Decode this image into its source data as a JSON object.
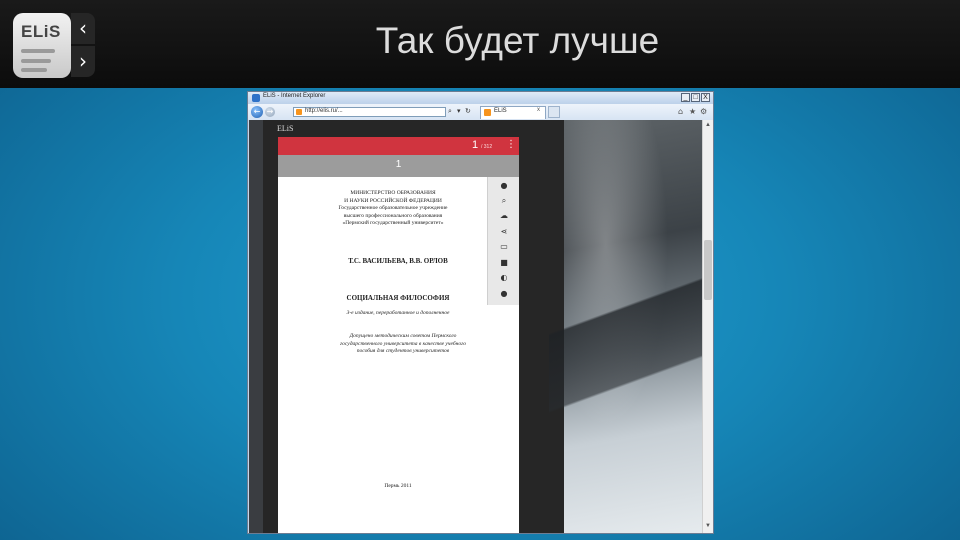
{
  "slide": {
    "title": "Так будет лучше",
    "logo": {
      "text": "ELiS",
      "arrow_top": "‹",
      "arrow_bottom": "›"
    }
  },
  "browser": {
    "title": "ELiS - Internet Explorer",
    "controls": {
      "minimize": "_",
      "maximize": "□",
      "close": "X"
    },
    "address": "http://elis.ru/...",
    "tab_label": "ELiS",
    "tab_close": "x"
  },
  "reader": {
    "brand": "ELiS",
    "page_current": "1",
    "page_total": "/ 312",
    "menu": "⋮",
    "page_indicator": "1",
    "tools": [
      "user-icon",
      "search-icon",
      "download-icon",
      "share-icon",
      "fullscreen-icon",
      "view-icon",
      "contrast-icon",
      "settings-icon"
    ]
  },
  "document": {
    "ministry": [
      "МИНИСТЕРСТВО ОБРАЗОВАНИЯ",
      "И НАУКИ РОССИЙСКОЙ ФЕДЕРАЦИИ",
      "Государственное образовательное учреждение",
      "высшего профессионального образования",
      "«Пермский государственный университет»"
    ],
    "authors": "Т.С. ВАСИЛЬЕВА, В.В. ОРЛОВ",
    "title": "СОЦИАЛЬНАЯ ФИЛОСОФИЯ",
    "edition": "3-е издание, переработанное и дополненное",
    "approval": [
      "Допущено методическим советом Пермского",
      "государственного университета в качестве учебного",
      "пособия для студентов университетов"
    ],
    "city_year": "Пермь 2011"
  }
}
